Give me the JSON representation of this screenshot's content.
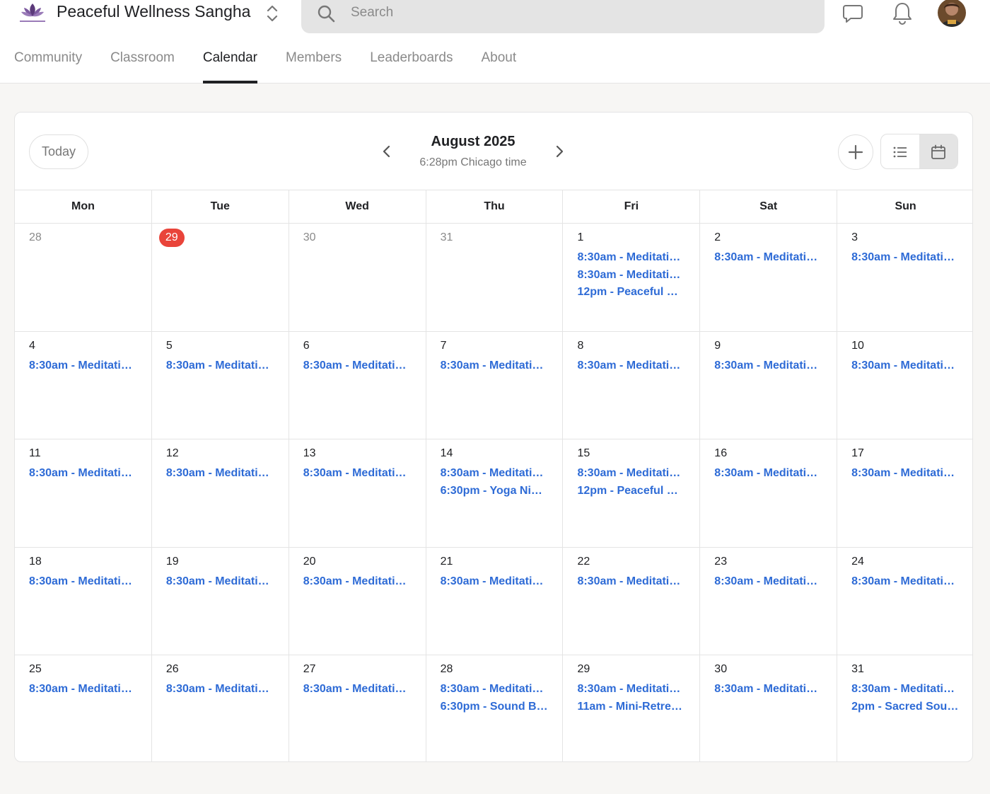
{
  "header": {
    "brand": "Peaceful Wellness Sangha",
    "logo": "lotus-logo",
    "search_placeholder": "Search",
    "icons": [
      "switcher-icon",
      "search-icon",
      "chat-icon",
      "bell-icon",
      "avatar"
    ]
  },
  "tabs": [
    {
      "label": "Community",
      "active": false
    },
    {
      "label": "Classroom",
      "active": false
    },
    {
      "label": "Calendar",
      "active": true
    },
    {
      "label": "Members",
      "active": false
    },
    {
      "label": "Leaderboards",
      "active": false
    },
    {
      "label": "About",
      "active": false
    }
  ],
  "calendar": {
    "today_label": "Today",
    "month": "August 2025",
    "timezone_text": "6:28pm Chicago time",
    "view": "calendar",
    "accent": "#2e6bd6",
    "today_badge_color": "#e9443a",
    "weekdays": [
      "Mon",
      "Tue",
      "Wed",
      "Thu",
      "Fri",
      "Sat",
      "Sun"
    ],
    "weeks": [
      [
        {
          "day": "28",
          "other": true,
          "events": []
        },
        {
          "day": "29",
          "today": true,
          "events": []
        },
        {
          "day": "30",
          "other": true,
          "events": []
        },
        {
          "day": "31",
          "other": true,
          "events": []
        },
        {
          "day": "1",
          "events": [
            "8:30am - Meditatio…",
            "8:30am - Meditatio…",
            "12pm - Peaceful M…"
          ]
        },
        {
          "day": "2",
          "events": [
            "8:30am - Meditatio…"
          ]
        },
        {
          "day": "3",
          "events": [
            "8:30am - Meditatio…"
          ]
        }
      ],
      [
        {
          "day": "4",
          "events": [
            "8:30am - Meditatio…"
          ]
        },
        {
          "day": "5",
          "events": [
            "8:30am - Meditatio…"
          ]
        },
        {
          "day": "6",
          "events": [
            "8:30am - Meditatio…"
          ]
        },
        {
          "day": "7",
          "events": [
            "8:30am - Meditatio…"
          ]
        },
        {
          "day": "8",
          "events": [
            "8:30am - Meditatio…"
          ]
        },
        {
          "day": "9",
          "events": [
            "8:30am - Meditatio…"
          ]
        },
        {
          "day": "10",
          "events": [
            "8:30am - Meditatio…"
          ]
        }
      ],
      [
        {
          "day": "11",
          "events": [
            "8:30am - Meditatio…"
          ]
        },
        {
          "day": "12",
          "events": [
            "8:30am - Meditatio…"
          ]
        },
        {
          "day": "13",
          "events": [
            "8:30am - Meditatio…"
          ]
        },
        {
          "day": "14",
          "events": [
            "8:30am - Meditatio…",
            "6:30pm - Yoga Nid…"
          ]
        },
        {
          "day": "15",
          "events": [
            "8:30am - Meditatio…",
            "12pm - Peaceful M…"
          ]
        },
        {
          "day": "16",
          "events": [
            "8:30am - Meditatio…"
          ]
        },
        {
          "day": "17",
          "events": [
            "8:30am - Meditatio…"
          ]
        }
      ],
      [
        {
          "day": "18",
          "events": [
            "8:30am - Meditatio…"
          ]
        },
        {
          "day": "19",
          "events": [
            "8:30am - Meditatio…"
          ]
        },
        {
          "day": "20",
          "events": [
            "8:30am - Meditatio…"
          ]
        },
        {
          "day": "21",
          "events": [
            "8:30am - Meditatio…"
          ]
        },
        {
          "day": "22",
          "events": [
            "8:30am - Meditatio…"
          ]
        },
        {
          "day": "23",
          "events": [
            "8:30am - Meditatio…"
          ]
        },
        {
          "day": "24",
          "events": [
            "8:30am - Meditatio…"
          ]
        }
      ],
      [
        {
          "day": "25",
          "events": [
            "8:30am - Meditatio…"
          ]
        },
        {
          "day": "26",
          "events": [
            "8:30am - Meditatio…"
          ]
        },
        {
          "day": "27",
          "events": [
            "8:30am - Meditatio…"
          ]
        },
        {
          "day": "28",
          "events": [
            "8:30am - Meditatio…",
            "6:30pm - Sound Ba…"
          ]
        },
        {
          "day": "29",
          "events": [
            "8:30am - Meditatio…",
            "11am - Mini-Retre…"
          ]
        },
        {
          "day": "30",
          "events": [
            "8:30am - Meditatio…"
          ]
        },
        {
          "day": "31",
          "events": [
            "8:30am - Meditatio…",
            "2pm - Sacred Soun…"
          ]
        }
      ]
    ]
  }
}
